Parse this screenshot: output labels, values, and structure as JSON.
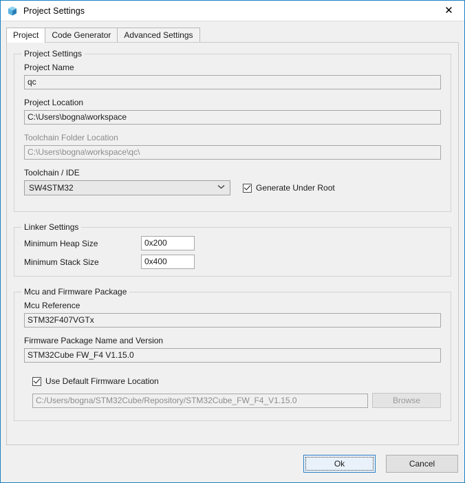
{
  "window": {
    "title": "Project Settings",
    "icon": "cube-icon",
    "close_label": "✕",
    "accent_color": "#1a7fc1"
  },
  "tabs": [
    {
      "label": "Project",
      "active": true
    },
    {
      "label": "Code Generator",
      "active": false
    },
    {
      "label": "Advanced Settings",
      "active": false
    }
  ],
  "project_settings": {
    "group_title": "Project Settings",
    "project_name": {
      "label": "Project Name",
      "value": "qc"
    },
    "project_location": {
      "label": "Project Location",
      "value": "C:\\Users\\bogna\\workspace"
    },
    "toolchain_folder_location": {
      "label": "Toolchain Folder Location",
      "value": "C:\\Users\\bogna\\workspace\\qc\\"
    },
    "toolchain_ide": {
      "label": "Toolchain / IDE",
      "value": "SW4STM32",
      "chevron": "⌄"
    },
    "generate_under_root": {
      "label": "Generate Under Root",
      "checked": true
    }
  },
  "linker_settings": {
    "group_title": "Linker Settings",
    "minimum_heap_size": {
      "label": "Minimum Heap Size",
      "value": "0x200"
    },
    "minimum_stack_size": {
      "label": "Minimum Stack Size",
      "value": "0x400"
    }
  },
  "mcu_firmware": {
    "group_title": "Mcu and Firmware Package",
    "mcu_reference": {
      "label": "Mcu Reference",
      "value": "STM32F407VGTx"
    },
    "firmware_package": {
      "label": "Firmware Package Name and Version",
      "value": "STM32Cube FW_F4 V1.15.0"
    },
    "use_default_firmware_location": {
      "label": "Use Default Firmware Location",
      "checked": true
    },
    "firmware_path": {
      "value": "C:/Users/bogna/STM32Cube/Repository/STM32Cube_FW_F4_V1.15.0"
    },
    "browse_label": "Browse"
  },
  "footer": {
    "ok_label": "Ok",
    "cancel_label": "Cancel"
  }
}
